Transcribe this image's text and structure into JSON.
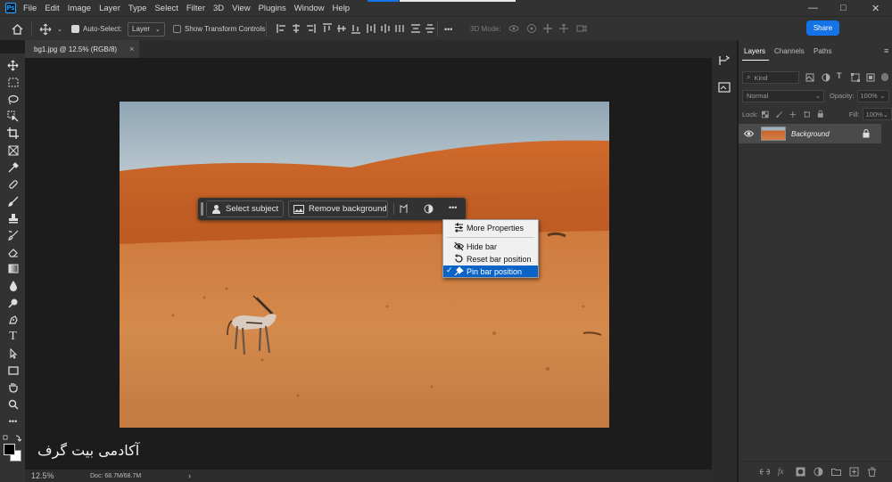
{
  "app": {
    "logo": "Ps"
  },
  "menu": [
    "File",
    "Edit",
    "Image",
    "Layer",
    "Type",
    "Select",
    "Filter",
    "3D",
    "View",
    "Plugins",
    "Window",
    "Help"
  ],
  "window_controls": {
    "minimize": "—",
    "maximize": "□",
    "close": "✕"
  },
  "options": {
    "auto_select_label": "Auto-Select:",
    "auto_select_checked": true,
    "auto_select_target": "Layer",
    "show_transform_label": "Show Transform Controls",
    "show_transform_checked": false,
    "more_label": "•••",
    "mode_3d_label": "3D Mode:",
    "share_label": "Share"
  },
  "document": {
    "tab_title": "bg1.jpg @ 12.5% (RGB/8)",
    "tab_close": "×"
  },
  "context_bar": {
    "select_subject": "Select subject",
    "remove_background": "Remove background",
    "more": "•••"
  },
  "context_menu": {
    "items": [
      {
        "label": "More Properties",
        "icon": "sliders-icon",
        "checked": false
      },
      {
        "label": "Hide bar",
        "icon": "eye-hidden-icon",
        "checked": false
      },
      {
        "label": "Reset bar position",
        "icon": "reset-icon",
        "checked": false
      },
      {
        "label": "Pin bar position",
        "icon": "pin-icon",
        "checked": true,
        "highlighted": true
      }
    ]
  },
  "status": {
    "zoom": "12.5%",
    "doc_info": "Doc: 68.7M/68.7M",
    "arrow": "›"
  },
  "watermark": "آکادمی بیت گرف",
  "layers_panel": {
    "tabs": [
      "Layers",
      "Channels",
      "Paths"
    ],
    "active_tab": "Layers",
    "filter_kind": "Kind",
    "blend_mode": "Normal",
    "opacity_label": "Opacity:",
    "opacity_value": "100%",
    "lock_label": "Lock:",
    "fill_label": "Fill:",
    "fill_value": "100%",
    "layers": [
      {
        "name": "Background",
        "visible": true,
        "locked": true
      }
    ]
  },
  "colors": {
    "accent": "#1473e6",
    "highlight": "#0a64c8",
    "panel": "#323232",
    "canvas_bg": "#1c1c1c"
  }
}
